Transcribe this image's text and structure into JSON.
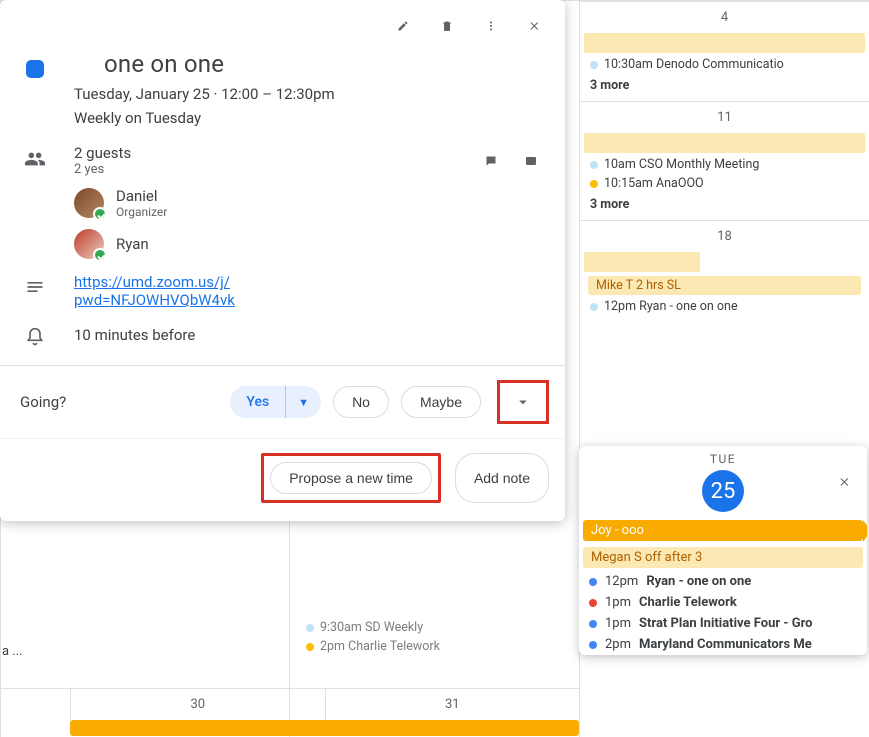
{
  "event": {
    "title": "one on one",
    "date_line": "Tuesday, January 25  ·  12:00 – 12:30pm",
    "recurrence": "Weekly on Tuesday",
    "guests_count": "2 guests",
    "guests_yes": "2 yes",
    "guests": [
      {
        "name": "Daniel",
        "role": "Organizer"
      },
      {
        "name": "Ryan",
        "role": ""
      }
    ],
    "link_url": "https://umd.zoom.us/j/",
    "link_pwd": "pwd=NFJOWHVQbW4vk",
    "reminder": "10 minutes before"
  },
  "rsvp": {
    "prompt": "Going?",
    "yes": "Yes",
    "no": "No",
    "maybe": "Maybe",
    "propose": "Propose a new time",
    "add_note": "Add note"
  },
  "daypeek": {
    "dow": "TUE",
    "num": "25",
    "allday": [
      {
        "label": "Joy - ooo",
        "chevron": true,
        "lite": false
      },
      {
        "label": "Megan S off after 3",
        "chevron": false,
        "lite": true
      }
    ],
    "events": [
      {
        "color": "blue",
        "time": "12pm",
        "title": "Ryan - one on one"
      },
      {
        "color": "dotred",
        "time": "1pm",
        "title": "Charlie Telework"
      },
      {
        "color": "blue",
        "time": "1pm",
        "title": "Strat Plan Initiative Four - Gro"
      },
      {
        "color": "blue",
        "time": "2pm",
        "title": "Maryland Communicators Me"
      }
    ]
  },
  "right_col": {
    "weeks": [
      {
        "num": "4",
        "allday": true,
        "events": [
          {
            "color": "pale",
            "text": "10:30am Denodo Communicatio"
          }
        ],
        "more": "3 more"
      },
      {
        "num": "11",
        "allday": true,
        "events": [
          {
            "color": "pale",
            "text": "10am CSO Monthly Meeting"
          },
          {
            "color": "peach",
            "text": "10:15am AnaOOO"
          }
        ],
        "more": "3 more"
      },
      {
        "num": "18",
        "allday_partial": true,
        "chip": "Mike T 2 hrs SL",
        "events": [
          {
            "color": "pale",
            "text": "12pm Ryan - one on one"
          }
        ]
      }
    ]
  },
  "mid_col": {
    "events": [
      {
        "color": "pale",
        "text": "9:30am SD Weekly"
      },
      {
        "color": "peach",
        "text": "2pm Charlie Telework"
      }
    ]
  },
  "bottom_dates": {
    "left": "30",
    "right": "31"
  },
  "left_trunc": "a ..."
}
